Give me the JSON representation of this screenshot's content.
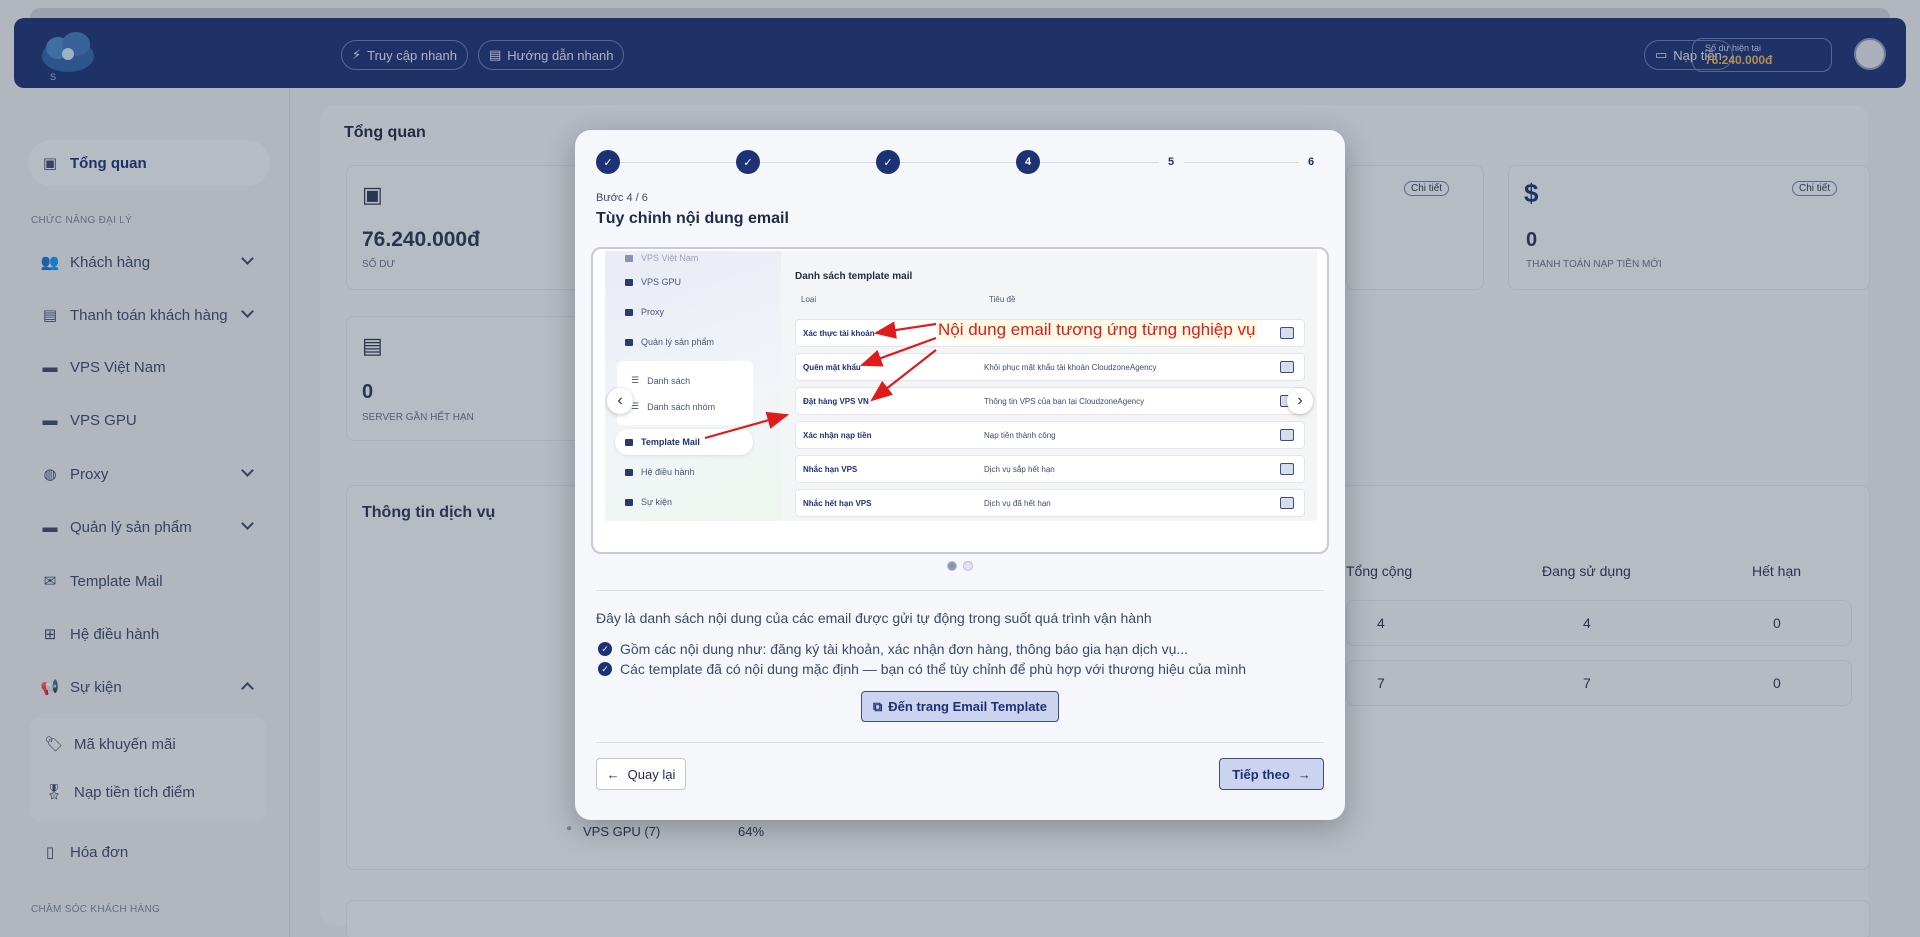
{
  "header": {
    "quick_access": "Truy cập nhanh",
    "quick_guide": "Hướng dẫn nhanh",
    "deposit": "Nạp tiền",
    "balance_label": "Số dư hiện tại",
    "balance_value": "76.240.000đ"
  },
  "sidebar": {
    "overview": "Tổng quan",
    "section_agent": "CHỨC NĂNG ĐẠI LÝ",
    "items": [
      {
        "label": "Khách hàng"
      },
      {
        "label": "Thanh toán khách hàng"
      },
      {
        "label": "VPS Việt Nam"
      },
      {
        "label": "VPS GPU"
      },
      {
        "label": "Proxy"
      },
      {
        "label": "Quản lý sản phẩm"
      },
      {
        "label": "Template Mail"
      },
      {
        "label": "Hệ điều hành"
      },
      {
        "label": "Sự kiện"
      }
    ],
    "sub_items": [
      {
        "label": "Mã khuyến mãi"
      },
      {
        "label": "Nạp tiền tích điểm"
      }
    ],
    "invoice": "Hóa đơn",
    "section_care": "CHĂM SÓC KHÁCH HÀNG"
  },
  "main": {
    "title": "Tổng quan",
    "balance_value": "76.240.000đ",
    "balance_label": "SỐ DƯ",
    "detail_label": "Chi tiết",
    "topup_value": "0",
    "topup_label": "THANH TOÁN NẠP TIỀN MỚI",
    "expire_value": "0",
    "expire_label": "SERVER GẦN HẾT HẠN",
    "service_title": "Thông tin dịch vụ",
    "table_headers": [
      "Tổng cộng",
      "Đang sử dụng",
      "Hết hạn"
    ],
    "table_rows": [
      [
        "4",
        "4",
        "0"
      ],
      [
        "7",
        "7",
        "0"
      ]
    ],
    "legend_gpu": "VPS GPU (7)",
    "legend_gpu_pct": "64%"
  },
  "modal": {
    "steps": [
      "4",
      "5",
      "6"
    ],
    "step_label": "Bước 4 / 6",
    "title": "Tùy chỉnh nội dung email",
    "screenshot": {
      "sidebar_items": [
        "VPS Việt Nam",
        "VPS GPU",
        "Proxy",
        "Quản lý sản phẩm",
        "Danh sách",
        "Danh sách nhóm",
        "Template Mail",
        "Hệ điều hành",
        "Sự kiện"
      ],
      "title": "Danh sách template mail",
      "col_type": "Loại",
      "col_subject": "Tiêu đề",
      "rows": [
        {
          "type": "Xác thực tài khoản",
          "subject": ""
        },
        {
          "type": "Quên mật khẩu",
          "subject": "Khôi phục mật khẩu tài khoản CloudzoneAgency"
        },
        {
          "type": "Đặt hàng VPS VN",
          "subject": "Thông tin VPS của bạn tại CloudzoneAgency"
        },
        {
          "type": "Xác nhận nạp tiền",
          "subject": "Nạp tiền thành công"
        },
        {
          "type": "Nhắc hạn VPS",
          "subject": "Dịch vụ sắp hết hạn"
        },
        {
          "type": "Nhắc hết hạn VPS",
          "subject": "Dịch vụ đã hết hạn"
        }
      ],
      "annotation": "Nội dung email tương ứng từng nghiệp vụ"
    },
    "description": "Đây là danh sách nội dung của các email được gửi tự động trong suốt quá trình vận hành",
    "bullets": [
      "Gồm các nội dung như: đăng ký tài khoản, xác nhận đơn hàng, thông báo gia hạn dịch vụ...",
      "Các template đã có nội dung mặc định — bạn có thể tùy chỉnh để phù hợp với thương hiệu của mình"
    ],
    "cta": "Đến trang Email Template",
    "back": "Quay lại",
    "next": "Tiếp theo"
  },
  "colors": {
    "primary": "#1d3275",
    "accent_gold": "#e9b452",
    "annotation_red": "#e01b1b"
  }
}
